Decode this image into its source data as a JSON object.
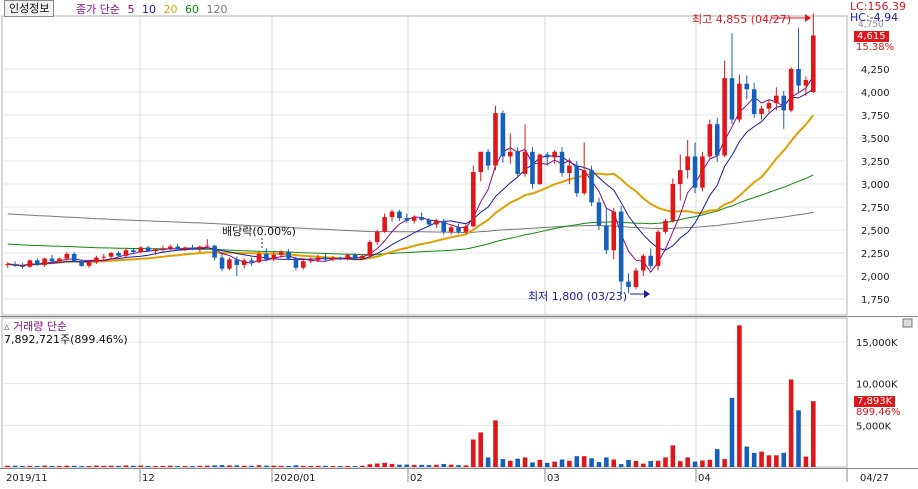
{
  "toolbar": {
    "stock_info_label": "인성정보",
    "indicator_name": "종가 단순",
    "ma_periods": [
      "5",
      "10",
      "20",
      "60",
      "120"
    ],
    "ma_colors": [
      "#8b0a8b",
      "#1a1aa6",
      "#e0a000",
      "#118811",
      "#777777"
    ]
  },
  "price_labels": {
    "lc": "LC:156.39",
    "hc": "HC:-4.94",
    "current_price": "4,615",
    "current_change": "15.38%",
    "high_annotation": "최고 4,855 (04/27)",
    "low_annotation": "최저 1,800 (03/23)",
    "dividend_annotation": "배당락(0.00%)",
    "top_partial": "4,750"
  },
  "volume_header": {
    "title": "거래량 단순",
    "value_text": "7,892,721주(899.46%)",
    "current_volume": "7,893K",
    "current_ratio": "899.46%"
  },
  "chart_data": [
    {
      "type": "candlestick",
      "title": "",
      "y_ticks": [
        "4,250",
        "4,000",
        "3,750",
        "3,500",
        "3,250",
        "3,000",
        "2,750",
        "2,500",
        "2,250",
        "2,000",
        "1,750"
      ],
      "ylim": [
        1600,
        4900
      ],
      "x_ticks": [
        "2019/11",
        "12",
        "2020/01",
        "02",
        "03",
        "04",
        "04/27"
      ],
      "candles": [
        [
          2120,
          2150,
          2090,
          2130
        ],
        [
          2130,
          2160,
          2100,
          2110
        ],
        [
          2110,
          2140,
          2080,
          2100
        ],
        [
          2100,
          2180,
          2090,
          2170
        ],
        [
          2170,
          2190,
          2110,
          2120
        ],
        [
          2120,
          2200,
          2100,
          2190
        ],
        [
          2190,
          2230,
          2150,
          2160
        ],
        [
          2160,
          2200,
          2140,
          2190
        ],
        [
          2190,
          2260,
          2170,
          2240
        ],
        [
          2240,
          2260,
          2150,
          2160
        ],
        [
          2160,
          2180,
          2100,
          2110
        ],
        [
          2110,
          2160,
          2090,
          2150
        ],
        [
          2150,
          2220,
          2130,
          2200
        ],
        [
          2200,
          2240,
          2170,
          2210
        ],
        [
          2210,
          2260,
          2180,
          2250
        ],
        [
          2250,
          2270,
          2200,
          2220
        ],
        [
          2220,
          2300,
          2200,
          2280
        ],
        [
          2280,
          2300,
          2240,
          2260
        ],
        [
          2260,
          2320,
          2250,
          2310
        ],
        [
          2310,
          2330,
          2260,
          2270
        ],
        [
          2270,
          2300,
          2230,
          2290
        ],
        [
          2290,
          2330,
          2260,
          2300
        ],
        [
          2300,
          2340,
          2280,
          2320
        ],
        [
          2320,
          2350,
          2280,
          2290
        ],
        [
          2290,
          2320,
          2270,
          2310
        ],
        [
          2310,
          2340,
          2280,
          2300
        ],
        [
          2300,
          2330,
          2260,
          2320
        ],
        [
          2320,
          2400,
          2300,
          2330
        ],
        [
          2330,
          2340,
          2170,
          2200
        ],
        [
          2200,
          2240,
          2050,
          2080
        ],
        [
          2080,
          2200,
          2060,
          2180
        ],
        [
          2180,
          2210,
          2000,
          2120
        ],
        [
          2120,
          2190,
          2080,
          2170
        ],
        [
          2170,
          2200,
          2110,
          2150
        ],
        [
          2150,
          2260,
          2140,
          2240
        ],
        [
          2240,
          2300,
          2160,
          2180
        ],
        [
          2180,
          2260,
          2160,
          2230
        ],
        [
          2230,
          2280,
          2200,
          2260
        ],
        [
          2260,
          2290,
          2170,
          2190
        ],
        [
          2190,
          2210,
          2060,
          2090
        ],
        [
          2090,
          2180,
          2070,
          2160
        ],
        [
          2160,
          2200,
          2140,
          2170
        ],
        [
          2170,
          2230,
          2150,
          2200
        ],
        [
          2200,
          2240,
          2160,
          2180
        ],
        [
          2180,
          2220,
          2160,
          2200
        ],
        [
          2200,
          2210,
          2170,
          2190
        ],
        [
          2190,
          2240,
          2170,
          2230
        ],
        [
          2230,
          2250,
          2180,
          2190
        ],
        [
          2190,
          2230,
          2180,
          2220
        ],
        [
          2220,
          2390,
          2200,
          2370
        ],
        [
          2370,
          2500,
          2340,
          2480
        ],
        [
          2480,
          2680,
          2470,
          2640
        ],
        [
          2640,
          2720,
          2590,
          2700
        ],
        [
          2700,
          2720,
          2600,
          2630
        ],
        [
          2630,
          2680,
          2580,
          2600
        ],
        [
          2600,
          2660,
          2570,
          2640
        ],
        [
          2640,
          2690,
          2600,
          2610
        ],
        [
          2610,
          2630,
          2540,
          2560
        ],
        [
          2560,
          2620,
          2520,
          2600
        ],
        [
          2600,
          2620,
          2450,
          2480
        ],
        [
          2480,
          2560,
          2450,
          2530
        ],
        [
          2530,
          2570,
          2460,
          2480
        ],
        [
          2480,
          2560,
          2460,
          2540
        ],
        [
          2540,
          3200,
          2530,
          3130
        ],
        [
          3130,
          3350,
          3030,
          3350
        ],
        [
          3350,
          3380,
          3150,
          3200
        ],
        [
          3200,
          3850,
          3150,
          3770
        ],
        [
          3770,
          3800,
          3230,
          3300
        ],
        [
          3300,
          3550,
          3220,
          3350
        ],
        [
          3350,
          3400,
          3080,
          3110
        ],
        [
          3110,
          3650,
          3080,
          3350
        ],
        [
          3350,
          3400,
          2950,
          3000
        ],
        [
          3000,
          3330,
          2990,
          3320
        ],
        [
          3320,
          3350,
          3200,
          3290
        ],
        [
          3290,
          3370,
          3220,
          3350
        ],
        [
          3350,
          3400,
          3080,
          3120
        ],
        [
          3120,
          3280,
          3000,
          3200
        ],
        [
          3200,
          3250,
          2860,
          2900
        ],
        [
          2900,
          3450,
          2880,
          3150
        ],
        [
          3150,
          3200,
          2760,
          2800
        ],
        [
          2800,
          2850,
          2500,
          2550
        ],
        [
          2550,
          2740,
          2240,
          2280
        ],
        [
          2280,
          2740,
          2180,
          2700
        ],
        [
          2700,
          2760,
          1800,
          1940
        ],
        [
          1940,
          2030,
          1810,
          1880
        ],
        [
          1880,
          2090,
          1860,
          2060
        ],
        [
          2060,
          2240,
          2000,
          2220
        ],
        [
          2220,
          2300,
          2080,
          2110
        ],
        [
          2110,
          2500,
          2060,
          2480
        ],
        [
          2480,
          2620,
          2460,
          2600
        ],
        [
          2600,
          3060,
          2580,
          3000
        ],
        [
          3000,
          3320,
          2820,
          3150
        ],
        [
          3150,
          3480,
          3060,
          3300
        ],
        [
          3300,
          3450,
          2900,
          2960
        ],
        [
          2960,
          3350,
          2920,
          3300
        ],
        [
          3300,
          3700,
          3280,
          3650
        ],
        [
          3650,
          3720,
          3240,
          3310
        ],
        [
          3310,
          4340,
          3290,
          4150
        ],
        [
          4150,
          4640,
          3650,
          3700
        ],
        [
          3700,
          4190,
          3670,
          4090
        ],
        [
          4090,
          4180,
          3920,
          4030
        ],
        [
          4030,
          4100,
          3720,
          3760
        ],
        [
          3760,
          3850,
          3700,
          3820
        ],
        [
          3820,
          3920,
          3780,
          3880
        ],
        [
          3880,
          4050,
          3800,
          3960
        ],
        [
          3960,
          4010,
          3600,
          3800
        ],
        [
          3800,
          4270,
          3780,
          4250
        ],
        [
          4250,
          4700,
          4000,
          4070
        ],
        [
          4070,
          4170,
          3960,
          4130
        ],
        [
          4000,
          4855,
          3990,
          4615
        ]
      ]
    },
    {
      "type": "bar",
      "title": "",
      "ylabel": "",
      "y_ticks": [
        "15,000K",
        "10,000K",
        "5,000K"
      ],
      "ylim": [
        0,
        17000
      ],
      "volumes_k": [
        150,
        160,
        120,
        140,
        130,
        170,
        130,
        120,
        160,
        150,
        110,
        120,
        180,
        150,
        160,
        140,
        190,
        150,
        170,
        130,
        120,
        140,
        160,
        130,
        120,
        110,
        150,
        170,
        200,
        230,
        190,
        200,
        160,
        150,
        210,
        170,
        160,
        150,
        130,
        210,
        140,
        120,
        140,
        150,
        120,
        110,
        130,
        120,
        160,
        330,
        420,
        500,
        370,
        280,
        290,
        250,
        260,
        220,
        260,
        360,
        280,
        220,
        200,
        3300,
        4150,
        1150,
        5600,
        950,
        750,
        1000,
        1150,
        550,
        850,
        500,
        650,
        900,
        750,
        1300,
        1300,
        1050,
        600,
        1150,
        900,
        350,
        850,
        720,
        400,
        720,
        750,
        1150,
        2600,
        700,
        1150,
        650,
        780,
        870,
        2150,
        950,
        8300,
        17000,
        2450,
        1700,
        1850,
        1400,
        1400,
        1700,
        10500,
        6800,
        1250,
        7893
      ]
    }
  ]
}
